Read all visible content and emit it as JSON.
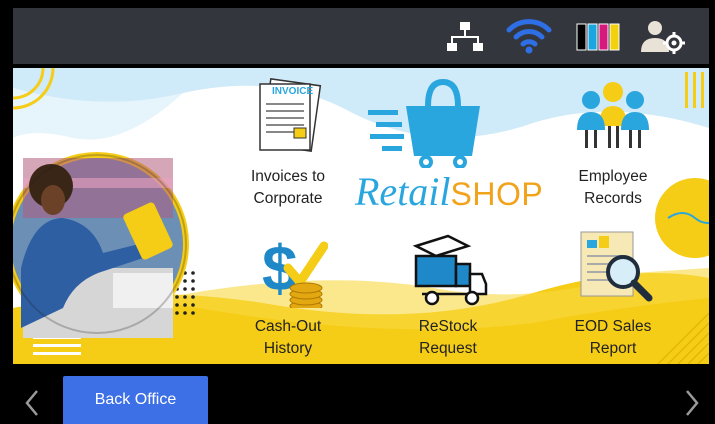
{
  "status_icons": [
    "network-icon",
    "wifi-icon",
    "ink-levels-icon",
    "user-settings-icon"
  ],
  "colors": {
    "statusbar": "#33363d",
    "wifi": "#2f6fe6",
    "yellow": "#f5cc16",
    "light_blue": "#cfeaf8",
    "button_blue": "#3d6fe6"
  },
  "ink_colors": [
    "#000000",
    "#1aa7e1",
    "#d6197c",
    "#f3d10f"
  ],
  "brand": {
    "retail": "Retail",
    "shop": "SHOP"
  },
  "tiles": [
    {
      "label_line1": "Invoices to",
      "label_line2": "Corporate",
      "icon": "invoice-icon"
    },
    {
      "label_line1": "Employee",
      "label_line2": "Records",
      "icon": "employees-icon"
    },
    {
      "label_line1": "Cash-Out",
      "label_line2": "History",
      "icon": "cash-icon"
    },
    {
      "label_line1": "ReStock",
      "label_line2": "Request",
      "icon": "truck-icon"
    },
    {
      "label_line1": "EOD Sales",
      "label_line2": "Report",
      "icon": "report-icon"
    }
  ],
  "invoice_word": "INVOICE",
  "bottom": {
    "back_office": "Back Office"
  }
}
